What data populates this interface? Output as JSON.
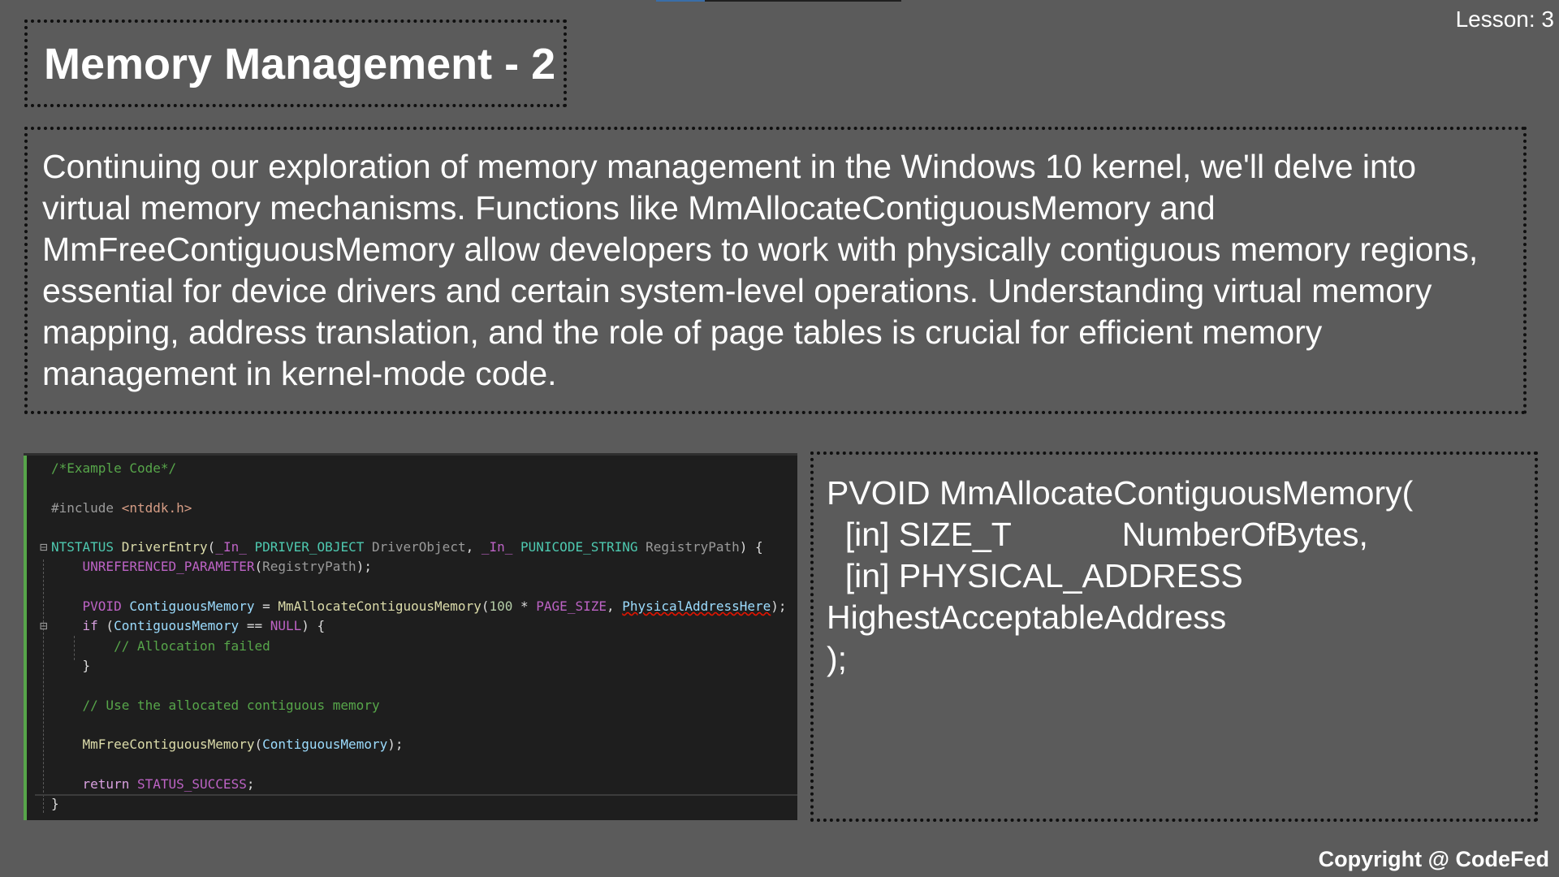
{
  "lesson_label": "Lesson: 3",
  "title": "Memory Management - 2",
  "description": "Continuing our exploration of memory management in the Windows 10 kernel, we'll delve into virtual memory mechanisms. Functions like MmAllocateContiguousMemory and MmFreeContiguousMemory allow developers to work with physically contiguous memory regions, essential for device drivers and certain system-level operations. Understanding virtual memory mapping, address translation, and the role of page tables is crucial for efficient memory management in kernel-mode code.",
  "code": {
    "comment_header": "/*Example Code*/",
    "include_directive": "#include",
    "include_file": "<ntddk.h>",
    "fn_return_type": "NTSTATUS",
    "fn_name": "DriverEntry",
    "in_macro": "_In_",
    "param1_type": "PDRIVER_OBJECT",
    "param1_name": "DriverObject",
    "param2_type": "PUNICODE_STRING",
    "param2_name": "RegistryPath",
    "unreferenced_macro": "UNREFERENCED_PARAMETER",
    "pvoid_type": "PVOID",
    "var_name": "ContiguousMemory",
    "alloc_fn": "MmAllocateContiguousMemory",
    "size_literal": "100",
    "page_size_macro": "PAGE_SIZE",
    "phys_addr_arg": "PhysicalAddressHere",
    "if_keyword": "if",
    "null_macro": "NULL",
    "alloc_failed_comment": "// Allocation failed",
    "use_memory_comment": "// Use the allocated contiguous memory",
    "free_fn": "MmFreeContiguousMemory",
    "return_keyword": "return",
    "status_success": "STATUS_SUCCESS"
  },
  "signature": {
    "line1": "PVOID MmAllocateContiguousMemory(",
    "line2": "  [in] SIZE_T            NumberOfBytes,",
    "line3": "  [in] PHYSICAL_ADDRESS",
    "line4": "HighestAcceptableAddress",
    "line5": ");"
  },
  "copyright": "Copyright @ CodeFed",
  "colors": {
    "background": "#5b5b5b",
    "code_background": "#1e1e1e",
    "comment_green": "#57a64a",
    "type_teal": "#4ec9b0",
    "macro_purple": "#bd63c5",
    "function_yellow": "#dcdcaa"
  }
}
